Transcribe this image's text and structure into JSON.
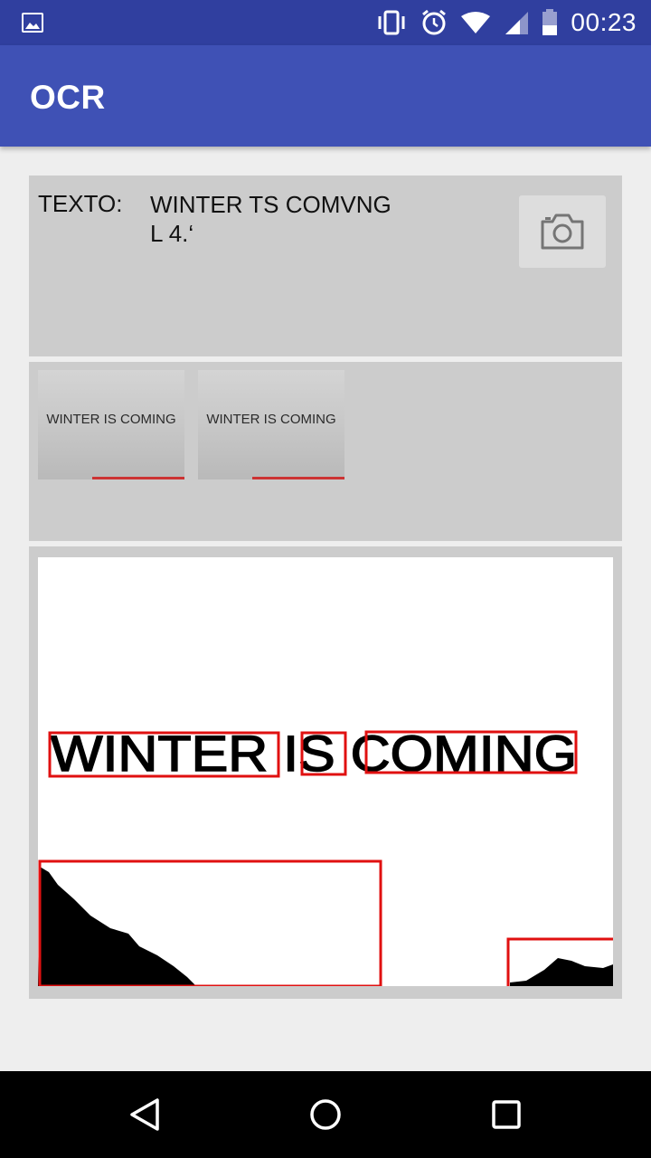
{
  "status_bar": {
    "time": "00:23",
    "icons": [
      "image-icon",
      "vibrate-icon",
      "alarm-icon",
      "wifi-icon",
      "signal-icon",
      "battery-icon"
    ]
  },
  "app_bar": {
    "title": "OCR"
  },
  "result_panel": {
    "label": "TEXTO:",
    "value": "WINTER TS COMVNG\nL 4.‘",
    "camera_icon": "camera-icon"
  },
  "thumbnails": [
    {
      "text": "WINTER IS COMING"
    },
    {
      "text": "WINTER IS COMING"
    }
  ],
  "processed_image": {
    "text": "WINTER IS COMING",
    "box_color": "#E01010"
  },
  "nav_bar": {
    "icons": [
      "back-icon",
      "home-icon",
      "recents-icon"
    ]
  },
  "colors": {
    "primary": "#3F51B5",
    "primary_dark": "#303F9F",
    "panel": "#CCCCCC",
    "background": "#EEEEEE"
  }
}
